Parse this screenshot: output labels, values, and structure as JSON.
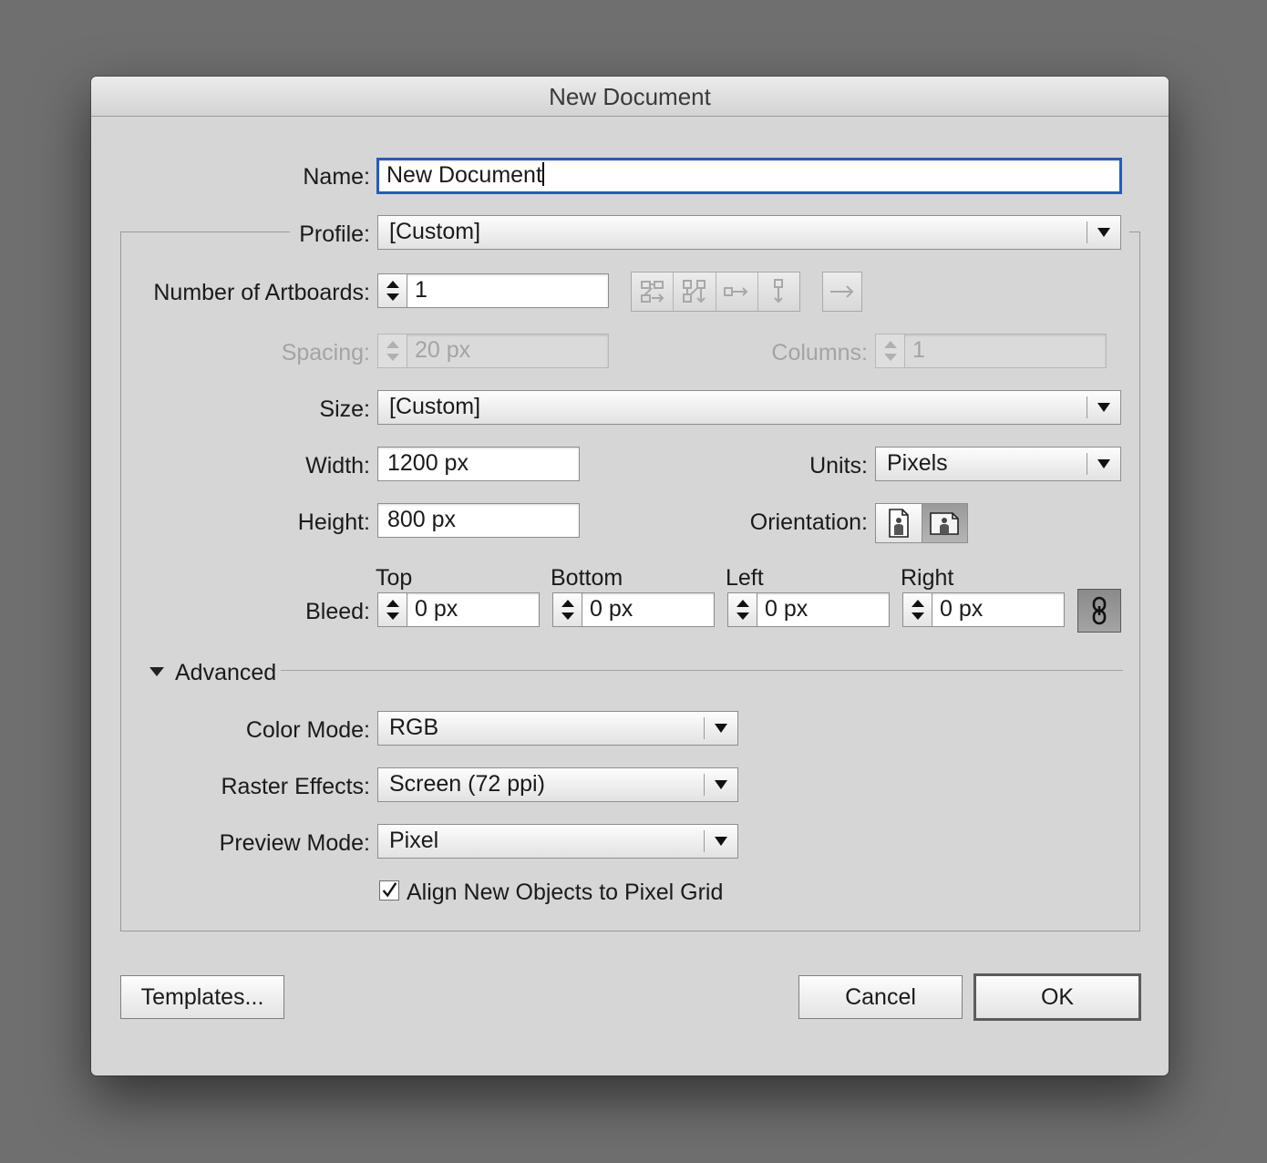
{
  "dialog": {
    "title": "New Document"
  },
  "name": {
    "label": "Name:",
    "value": "New Document"
  },
  "profile": {
    "label": "Profile:",
    "value": "[Custom]"
  },
  "artboards": {
    "label": "Number of Artboards:",
    "value": "1"
  },
  "spacing": {
    "label": "Spacing:",
    "value": "20 px"
  },
  "columns": {
    "label": "Columns:",
    "value": "1"
  },
  "size": {
    "label": "Size:",
    "value": "[Custom]"
  },
  "width": {
    "label": "Width:",
    "value": "1200 px"
  },
  "units": {
    "label": "Units:",
    "value": "Pixels"
  },
  "height": {
    "label": "Height:",
    "value": "800 px"
  },
  "orientation": {
    "label": "Orientation:"
  },
  "bleed": {
    "label": "Bleed:",
    "top": {
      "label": "Top",
      "value": "0 px"
    },
    "bottom": {
      "label": "Bottom",
      "value": "0 px"
    },
    "left": {
      "label": "Left",
      "value": "0 px"
    },
    "right": {
      "label": "Right",
      "value": "0 px"
    }
  },
  "advanced": {
    "label": "Advanced",
    "color_mode": {
      "label": "Color Mode:",
      "value": "RGB"
    },
    "raster_effects": {
      "label": "Raster Effects:",
      "value": "Screen (72 ppi)"
    },
    "preview_mode": {
      "label": "Preview Mode:",
      "value": "Pixel"
    },
    "align_pixel_grid": {
      "label": "Align New Objects to Pixel Grid",
      "checked": true
    }
  },
  "buttons": {
    "templates": "Templates...",
    "cancel": "Cancel",
    "ok": "OK"
  },
  "icons": {
    "artboard_layout": [
      "grid-by-row-icon",
      "grid-by-column-icon",
      "arrange-by-row-icon",
      "arrange-by-column-icon"
    ],
    "layout_direction": "arrow-right-icon",
    "orientation": [
      "portrait-icon",
      "landscape-icon"
    ],
    "link": "chain-link-icon"
  },
  "colors": {
    "focus": "#2a5ab8",
    "dialog_bg": "#d6d6d6",
    "backdrop": "#6f6f6f"
  }
}
